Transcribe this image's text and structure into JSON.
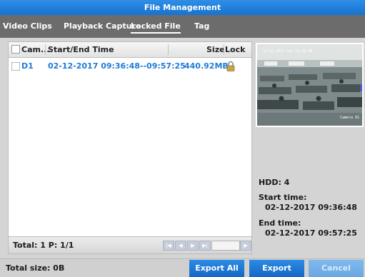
{
  "window": {
    "title": "File Management"
  },
  "tabs": [
    {
      "label": "Video Clips"
    },
    {
      "label": "Playback Capture"
    },
    {
      "label": "Locked File",
      "active": true
    },
    {
      "label": "Tag"
    }
  ],
  "table": {
    "columns": [
      "Cam...",
      "Start/End Time",
      "Size",
      "Lock"
    ],
    "rows": [
      {
        "camera": "D1",
        "time": "02-12-2017 09:36:48--09:57:25",
        "size": "440.92MB",
        "locked": true
      }
    ]
  },
  "pagination": {
    "total_label": "Total: 1  P: 1/1",
    "page_input_value": ""
  },
  "preview": {
    "timestamp": "12-02-2017 Sat 09:36:48",
    "camera_label": "Camera 01"
  },
  "info": {
    "hdd": "HDD: 4",
    "start_label": "Start time:",
    "start_value": "02-12-2017 09:36:48",
    "end_label": "End time:",
    "end_value": "02-12-2017 09:57:25"
  },
  "bottom": {
    "total_size": "Total size: 0B",
    "export_all": "Export All",
    "export": "Export",
    "cancel": "Cancel"
  },
  "colors": {
    "accent": "#1673cf",
    "row_text": "#1f7bd8",
    "tab_bar": "#6c6c6c"
  }
}
